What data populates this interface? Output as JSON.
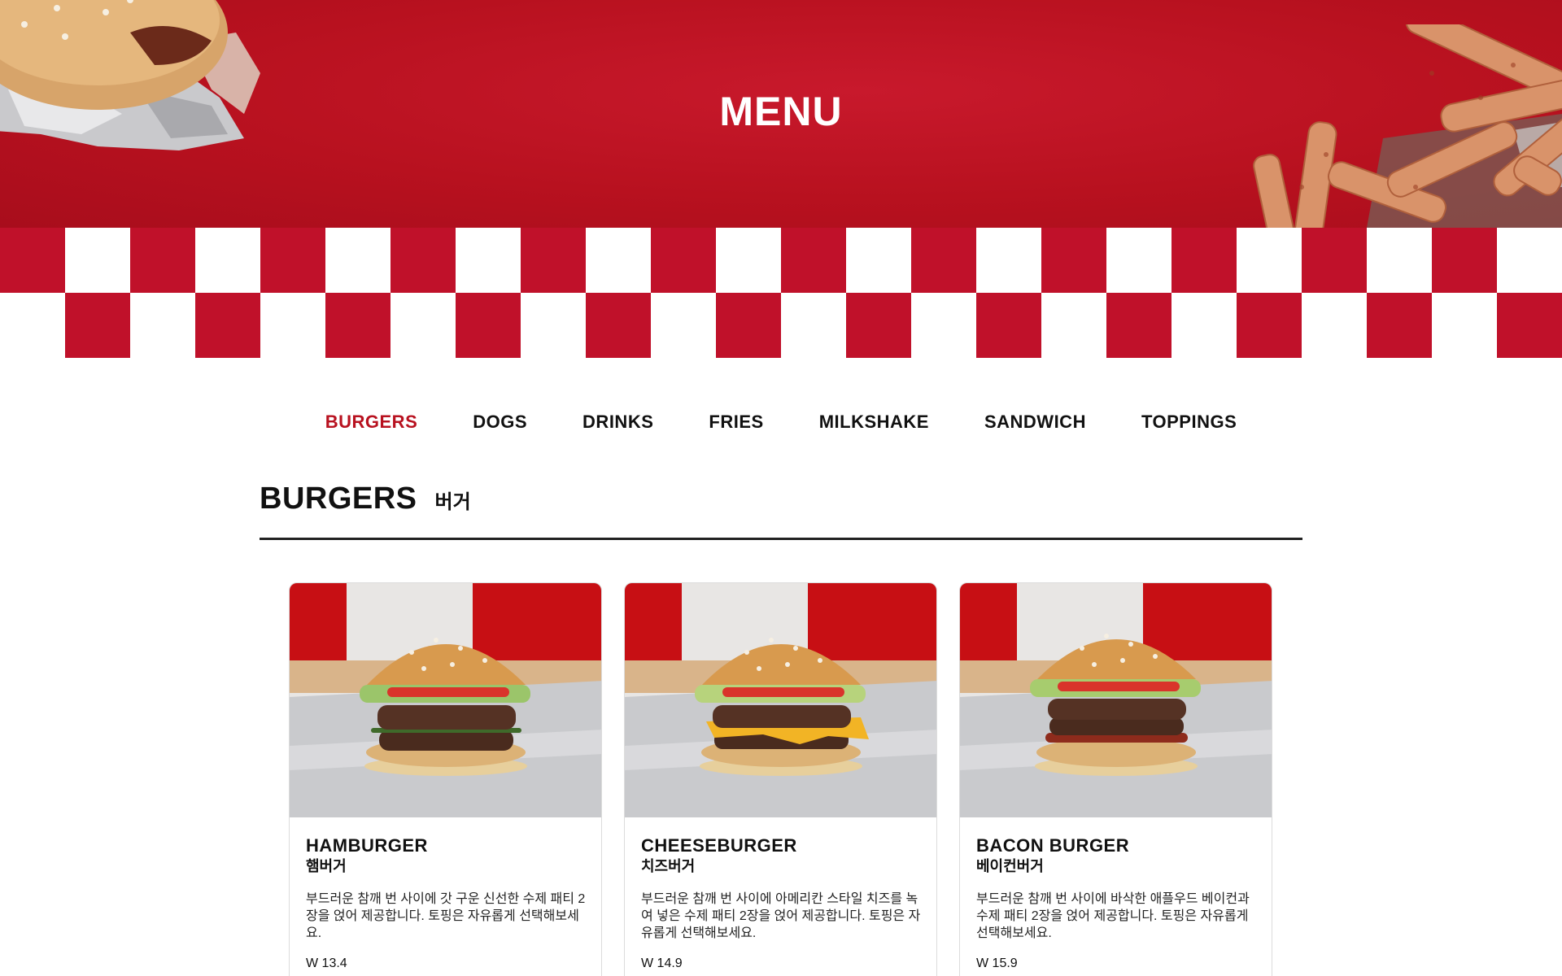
{
  "hero": {
    "title": "MENU"
  },
  "nav": {
    "items": [
      {
        "label": "BURGERS",
        "active": true
      },
      {
        "label": "DOGS"
      },
      {
        "label": "DRINKS"
      },
      {
        "label": "FRIES"
      },
      {
        "label": "MILKSHAKE"
      },
      {
        "label": "SANDWICH"
      },
      {
        "label": "TOPPINGS"
      }
    ]
  },
  "section": {
    "title": "BURGERS",
    "subtitle": "버거"
  },
  "cards": [
    {
      "name": "HAMBURGER",
      "name_kr": "햄버거",
      "description": "부드러운 참깨 번 사이에 갓 구운 신선한 수제 패티 2장을 얹어 제공합니다. 토핑은 자유롭게 선택해보세요.",
      "price": "W 13.4"
    },
    {
      "name": "CHEESEBURGER",
      "name_kr": "치즈버거",
      "description": "부드러운 참깨 번 사이에 아메리칸 스타일 치즈를 녹여 넣은 수제 패티 2장을 얹어 제공합니다. 토핑은 자유롭게 선택해보세요.",
      "price": "W 14.9"
    },
    {
      "name": "BACON BURGER",
      "name_kr": "베이컨버거",
      "description": "부드러운 참깨 번 사이에 바삭한 애플우드 베이컨과 수제 패티 2장을 얹어 제공합니다. 토핑은 자유롭게 선택해보세요.",
      "price": "W 15.9"
    }
  ],
  "colors": {
    "brand_red": "#b8111f",
    "checker_red": "#c0112a",
    "text": "#111111"
  }
}
